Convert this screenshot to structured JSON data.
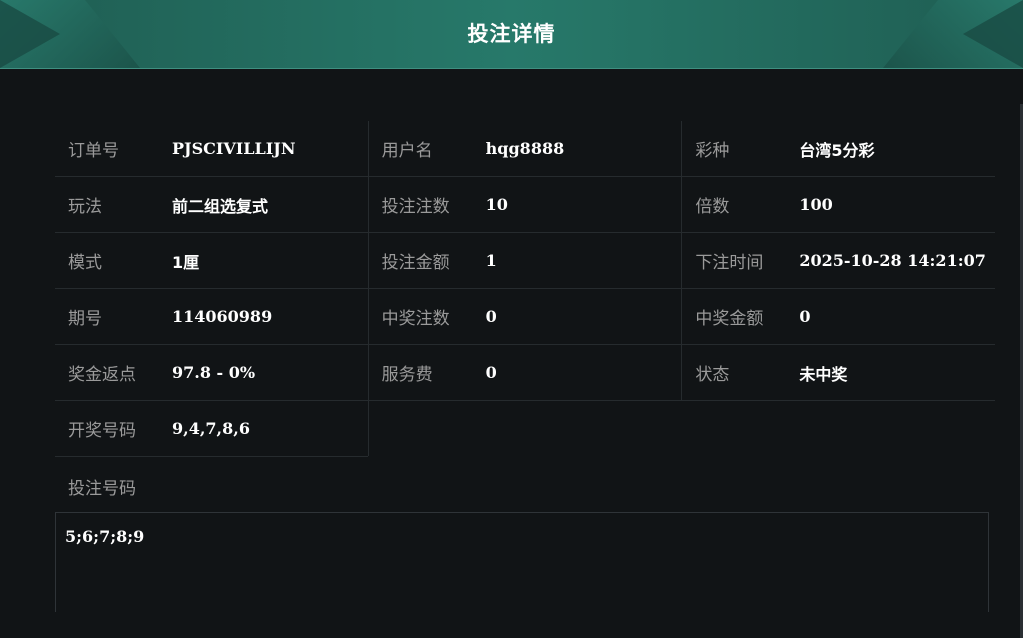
{
  "header": {
    "title": "投注详情"
  },
  "details": {
    "order_no": {
      "label": "订单号",
      "value": "PJSCIVILLIJN"
    },
    "username": {
      "label": "用户名",
      "value": "hqg8888"
    },
    "lottery": {
      "label": "彩种",
      "value": "台湾5分彩"
    },
    "play": {
      "label": "玩法",
      "value": "前二组选复式"
    },
    "bet_count": {
      "label": "投注注数",
      "value": "10"
    },
    "multiple": {
      "label": "倍数",
      "value": "100"
    },
    "mode": {
      "label": "模式",
      "value": "1厘"
    },
    "bet_amount": {
      "label": "投注金额",
      "value": "1"
    },
    "bet_time": {
      "label": "下注时间",
      "value": "2025-10-28 14:21:07"
    },
    "issue": {
      "label": "期号",
      "value": "114060989"
    },
    "win_count": {
      "label": "中奖注数",
      "value": "0"
    },
    "win_amount": {
      "label": "中奖金额",
      "value": "0"
    },
    "rebate": {
      "label": "奖金返点",
      "value": "97.8 - 0%"
    },
    "service_fee": {
      "label": "服务费",
      "value": "0"
    },
    "status": {
      "label": "状态",
      "value": "未中奖"
    },
    "draw_numbers": {
      "label": "开奖号码",
      "value": "9,4,7,8,6"
    }
  },
  "bet_numbers": {
    "label": "投注号码",
    "value": "5;6;7;8;9"
  },
  "colors": {
    "header_bg": "#27796a",
    "page_bg": "#111416",
    "label": "#9a9a9a",
    "value": "#ffffff"
  }
}
